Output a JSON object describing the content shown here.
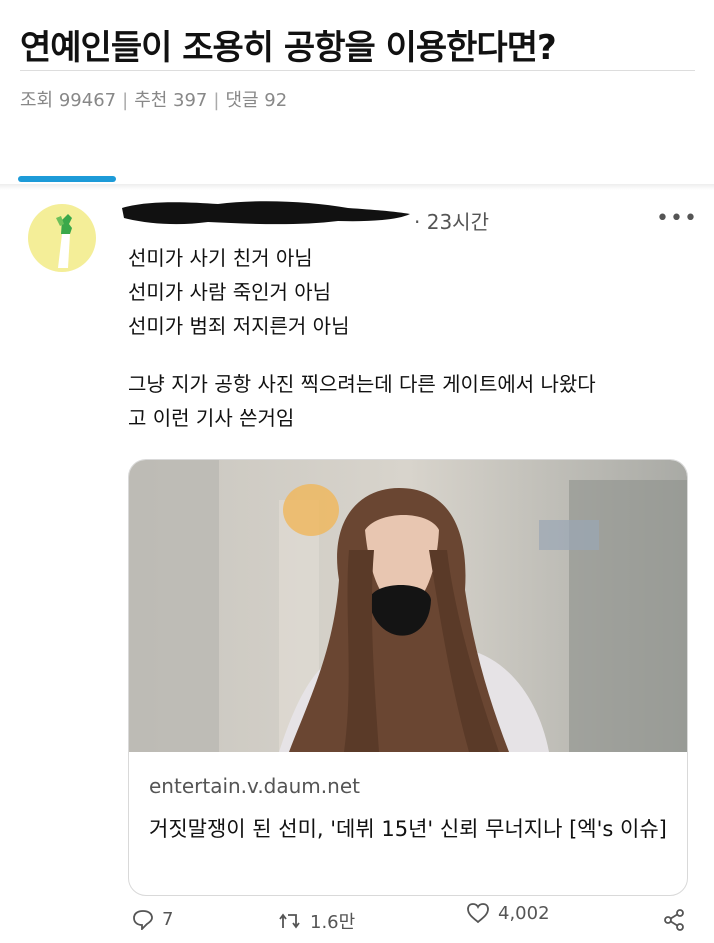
{
  "post": {
    "title": "연예인들이 조용히 공항을 이용한다면?",
    "views_label": "조회 99467",
    "recommend_label": "추천 397",
    "comments_label": "댓글 92"
  },
  "tweet": {
    "time": "· 23시간",
    "more": "•••",
    "lines": [
      "선미가 사기 친거 아님",
      "선미가 사람 죽인거 아님",
      "선미가 범죄 저지른거 아님",
      "그냥 지가 공항 사진 찍으려는데 다른 게이트에서 나왔다",
      "고 이런 기사 쓴거임"
    ],
    "link_card": {
      "domain": "entertain.v.daum.net",
      "headline": "거짓말쟁이 된 선미, '데뷔 15년' 신뢰 무너지나 [엑's 이슈]"
    },
    "actions": {
      "replies": "7",
      "retweets": "1.6만",
      "likes": "4,002"
    }
  },
  "colors": {
    "accent_bar": "#1d9bd8",
    "avatar_bg": "#f4ee98",
    "meta_text": "#888888"
  },
  "icons": [
    "reply-icon",
    "retweet-icon",
    "heart-icon",
    "share-icon",
    "more-icon"
  ]
}
